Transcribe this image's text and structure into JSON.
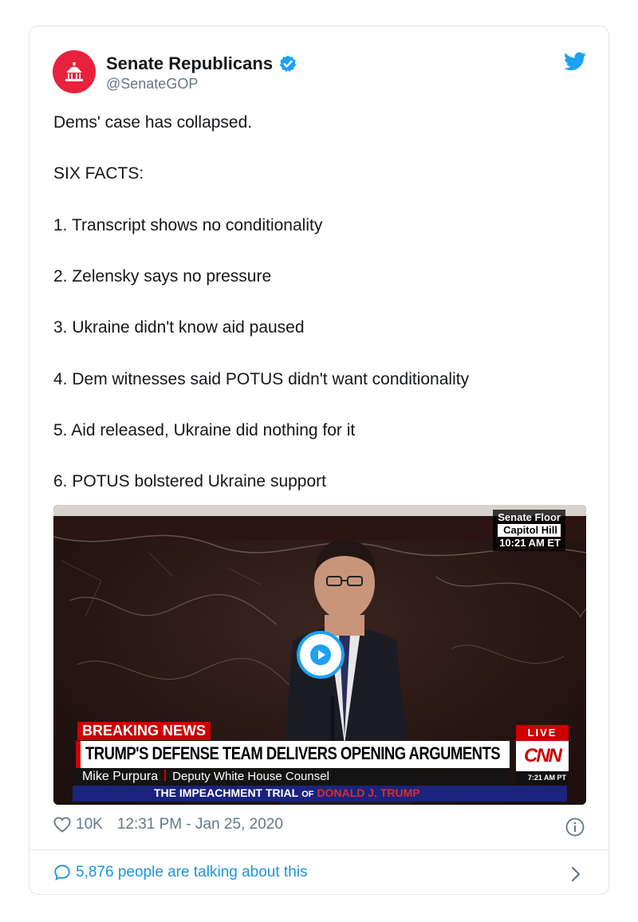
{
  "author": {
    "display_name": "Senate Republicans",
    "handle": "@SenateGOP",
    "verified": true,
    "avatar_color": "#e8213d"
  },
  "tweet": {
    "lines": [
      "Dems' case has collapsed.",
      "SIX FACTS:",
      "1. Transcript shows no conditionality",
      "2. Zelensky says no pressure",
      "3. Ukraine didn't know aid paused",
      "4. Dem witnesses said POTUS didn't want conditionality",
      "5. Aid released, Ukraine did nothing for it",
      "6. POTUS bolstered Ukraine support"
    ]
  },
  "video": {
    "location_top": "Senate Floor",
    "location_mid": "Capitol Hill",
    "location_time": "10:21 AM ET",
    "breaking": "BREAKING NEWS",
    "headline": "TRUMP'S DEFENSE TEAM DELIVERS OPENING ARGUMENTS",
    "speaker_name": "Mike Purpura",
    "speaker_title": "Deputy White House Counsel",
    "trial_prefix": "THE IMPEACHMENT TRIAL",
    "trial_of": "OF",
    "trial_name": "DONALD J. TRUMP",
    "live": "LIVE",
    "network": "CNN",
    "network_time": "7:21 AM PT"
  },
  "meta": {
    "likes": "10K",
    "timestamp": "12:31 PM - Jan 25, 2020"
  },
  "footer": {
    "talking": "5,876 people are talking about this"
  },
  "colors": {
    "link": "#1b95e0",
    "twitter_blue": "#1da1f2",
    "muted": "#657786",
    "cnn_red": "#cc0000"
  }
}
